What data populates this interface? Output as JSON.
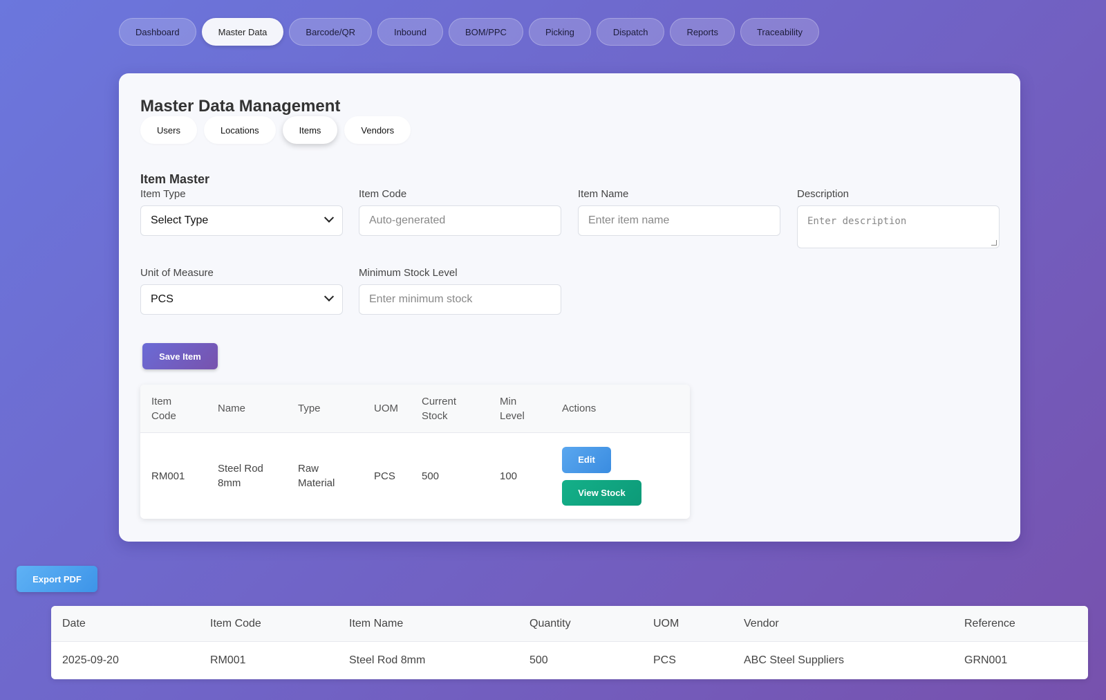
{
  "nav": {
    "items": [
      {
        "label": "Dashboard"
      },
      {
        "label": "Master Data"
      },
      {
        "label": "Barcode/QR"
      },
      {
        "label": "Inbound"
      },
      {
        "label": "BOM/PPC"
      },
      {
        "label": "Picking"
      },
      {
        "label": "Dispatch"
      },
      {
        "label": "Reports"
      },
      {
        "label": "Traceability"
      }
    ],
    "active": "Master Data"
  },
  "master": {
    "title": "Master Data Management",
    "tabs": [
      {
        "label": "Users"
      },
      {
        "label": "Locations"
      },
      {
        "label": "Items"
      },
      {
        "label": "Vendors"
      }
    ],
    "active_tab": "Items"
  },
  "item_master": {
    "title": "Item Master",
    "fields": {
      "item_type": {
        "label": "Item Type",
        "value": "Select Type"
      },
      "item_code": {
        "label": "Item Code",
        "placeholder": "Auto-generated"
      },
      "item_name": {
        "label": "Item Name",
        "placeholder": "Enter item name"
      },
      "description": {
        "label": "Description",
        "placeholder": "Enter description"
      },
      "uom": {
        "label": "Unit of Measure",
        "value": "PCS"
      },
      "min_stock": {
        "label": "Minimum Stock Level",
        "placeholder": "Enter minimum stock"
      }
    },
    "save_label": "Save Item"
  },
  "items_table": {
    "headers": [
      "Item\nCode",
      "Name",
      "Type",
      "UOM",
      "Current\nStock",
      "Min\nLevel",
      "Actions"
    ],
    "rows": [
      {
        "code": "RM001",
        "name": "Steel Rod 8mm",
        "type": "Raw Material",
        "uom": "PCS",
        "current_stock": "500",
        "min_level": "100",
        "edit_label": "Edit",
        "view_label": "View Stock"
      }
    ]
  },
  "export": {
    "label": "Export PDF"
  },
  "report_table": {
    "headers": [
      "Date",
      "Item Code",
      "Item Name",
      "Quantity",
      "UOM",
      "Vendor",
      "Reference"
    ],
    "rows": [
      {
        "date": "2025-09-20",
        "item_code": "RM001",
        "item_name": "Steel Rod 8mm",
        "quantity": "500",
        "uom": "PCS",
        "vendor": "ABC Steel Suppliers",
        "reference": "GRN001"
      }
    ]
  },
  "colors": {
    "background_start": "#6b77dd",
    "background_end": "#7751ad",
    "save_button": "#6a6bd6",
    "edit_button": "#4a9ae8",
    "view_stock_button": "#10a883",
    "export_button": "#4fa3ef"
  },
  "icons": {
    "select_arrow": "chevron-down-icon",
    "textarea_resize": "resize-grip-icon"
  }
}
